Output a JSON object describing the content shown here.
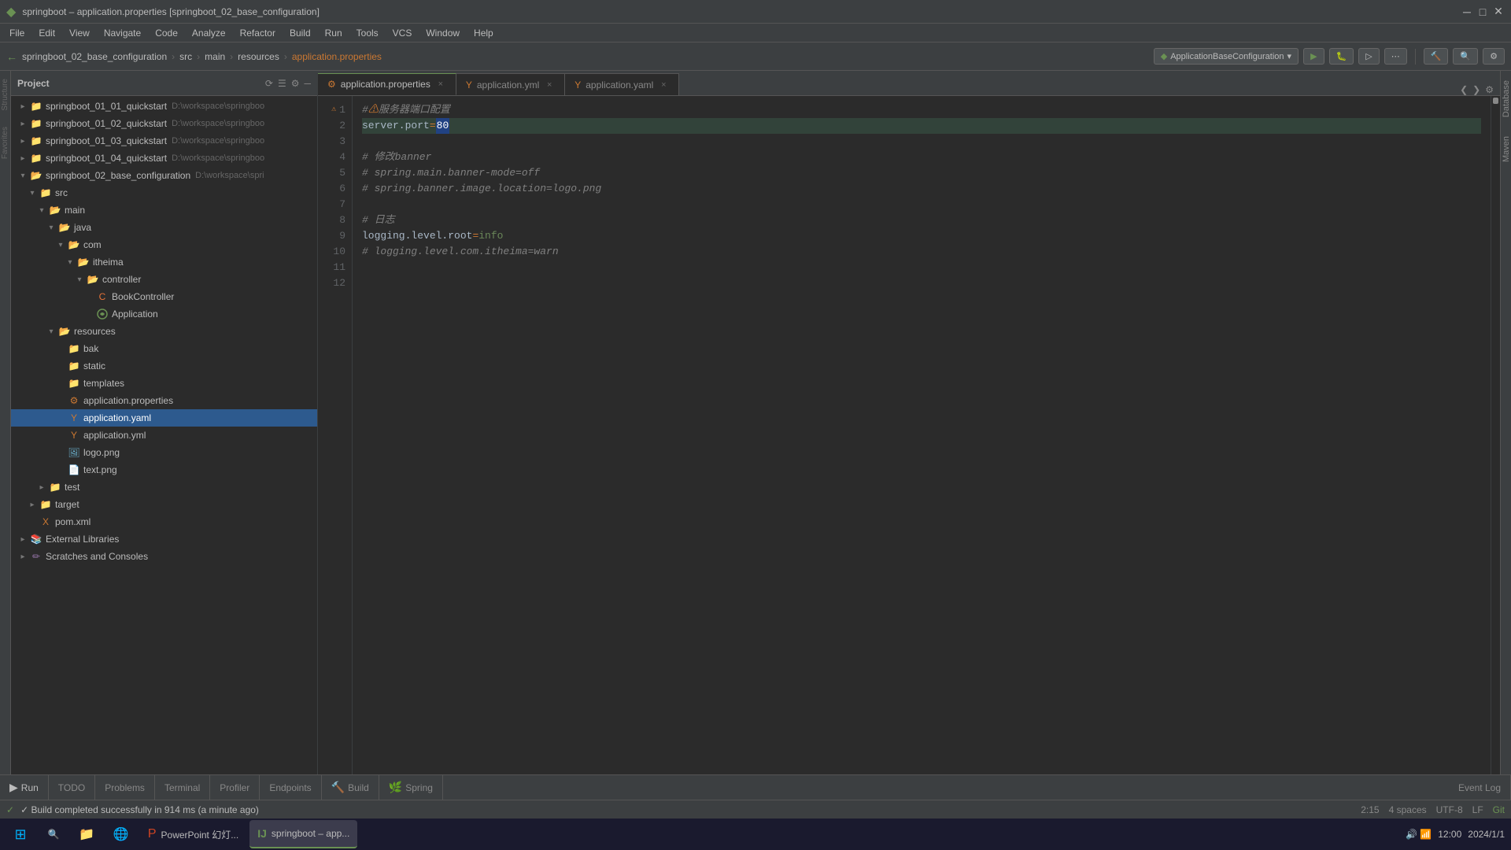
{
  "window": {
    "title": "springboot – application.properties [springboot_02_base_configuration]",
    "minimize": "─",
    "maximize": "□",
    "close": "✕"
  },
  "menu": {
    "items": [
      "File",
      "Edit",
      "View",
      "Navigate",
      "Code",
      "Analyze",
      "Refactor",
      "Build",
      "Run",
      "Tools",
      "VCS",
      "Window",
      "Help"
    ]
  },
  "toolbar": {
    "breadcrumb": [
      "springboot_02_base_configuration",
      "src",
      "main",
      "resources",
      "application.properties"
    ],
    "run_config": "ApplicationBaseConfiguration",
    "run_icon": "▶",
    "debug_icon": "🐛"
  },
  "project_panel": {
    "title": "Project",
    "dropdown_icon": "▾"
  },
  "tree": {
    "items": [
      {
        "id": "springboot_01_01",
        "label": "springboot_01_01_quickstart",
        "suffix": "D:\\workspace\\springboo",
        "indent": 1,
        "arrow": "closed",
        "type": "module"
      },
      {
        "id": "springboot_01_02",
        "label": "springboot_01_02_quickstart",
        "suffix": "D:\\workspace\\springboo",
        "indent": 1,
        "arrow": "closed",
        "type": "module"
      },
      {
        "id": "springboot_01_03",
        "label": "springboot_01_03_quickstart",
        "suffix": "D:\\workspace\\springboo",
        "indent": 1,
        "arrow": "closed",
        "type": "module"
      },
      {
        "id": "springboot_01_04",
        "label": "springboot_01_04_quickstart",
        "suffix": "D:\\workspace\\springboo",
        "indent": 1,
        "arrow": "closed",
        "type": "module"
      },
      {
        "id": "springboot_02",
        "label": "springboot_02_base_configuration",
        "suffix": "D:\\workspace\\spri",
        "indent": 1,
        "arrow": "open",
        "type": "module"
      },
      {
        "id": "src",
        "label": "src",
        "indent": 2,
        "arrow": "open",
        "type": "folder-src"
      },
      {
        "id": "main",
        "label": "main",
        "indent": 3,
        "arrow": "open",
        "type": "folder"
      },
      {
        "id": "java",
        "label": "java",
        "indent": 4,
        "arrow": "open",
        "type": "folder"
      },
      {
        "id": "com",
        "label": "com",
        "indent": 5,
        "arrow": "open",
        "type": "folder"
      },
      {
        "id": "itheima",
        "label": "itheima",
        "indent": 6,
        "arrow": "open",
        "type": "folder"
      },
      {
        "id": "controller",
        "label": "controller",
        "indent": 7,
        "arrow": "open",
        "type": "folder"
      },
      {
        "id": "BookController",
        "label": "BookController",
        "indent": 8,
        "arrow": "leaf",
        "type": "java-class"
      },
      {
        "id": "Application",
        "label": "Application",
        "indent": 8,
        "arrow": "leaf",
        "type": "spring"
      },
      {
        "id": "resources",
        "label": "resources",
        "indent": 4,
        "arrow": "open",
        "type": "folder"
      },
      {
        "id": "bak",
        "label": "bak",
        "indent": 5,
        "arrow": "leaf",
        "type": "folder"
      },
      {
        "id": "static",
        "label": "static",
        "indent": 5,
        "arrow": "leaf",
        "type": "folder"
      },
      {
        "id": "templates",
        "label": "templates",
        "indent": 5,
        "arrow": "leaf",
        "type": "folder"
      },
      {
        "id": "application.properties",
        "label": "application.properties",
        "indent": 5,
        "arrow": "leaf",
        "type": "properties"
      },
      {
        "id": "application.yaml",
        "label": "application.yaml",
        "indent": 5,
        "arrow": "leaf",
        "type": "yaml",
        "selected": true
      },
      {
        "id": "application.yml",
        "label": "application.yml",
        "indent": 5,
        "arrow": "leaf",
        "type": "yaml"
      },
      {
        "id": "logo.png",
        "label": "logo.png",
        "indent": 5,
        "arrow": "leaf",
        "type": "png"
      },
      {
        "id": "text.png",
        "label": "text.png",
        "indent": 5,
        "arrow": "leaf",
        "type": "png"
      },
      {
        "id": "test",
        "label": "test",
        "indent": 3,
        "arrow": "closed",
        "type": "folder"
      },
      {
        "id": "target",
        "label": "target",
        "indent": 2,
        "arrow": "closed",
        "type": "folder"
      },
      {
        "id": "pom.xml",
        "label": "pom.xml",
        "indent": 2,
        "arrow": "leaf",
        "type": "xml"
      },
      {
        "id": "external_libs",
        "label": "External Libraries",
        "indent": 1,
        "arrow": "closed",
        "type": "library"
      },
      {
        "id": "scratches",
        "label": "Scratches and Consoles",
        "indent": 1,
        "arrow": "closed",
        "type": "scratches"
      }
    ]
  },
  "tabs": [
    {
      "id": "application.properties",
      "label": "application.properties",
      "active": true,
      "modified": true,
      "type": "properties"
    },
    {
      "id": "application.yml",
      "label": "application.yml",
      "active": false,
      "modified": false,
      "type": "yaml"
    },
    {
      "id": "application.yaml",
      "label": "application.yaml",
      "active": false,
      "modified": false,
      "type": "yaml"
    }
  ],
  "editor": {
    "lines": [
      {
        "num": 1,
        "content": "#⚠️服务器端口配置",
        "type": "comment"
      },
      {
        "num": 2,
        "content": "server.port=80",
        "type": "property",
        "key": "server.port",
        "value": "80",
        "cursor": true
      },
      {
        "num": 3,
        "content": "",
        "type": "blank"
      },
      {
        "num": 4,
        "content": "# 修改banner",
        "type": "comment"
      },
      {
        "num": 5,
        "content": "# spring.main.banner-mode=off",
        "type": "comment"
      },
      {
        "num": 6,
        "content": "# spring.banner.image.location=logo.png",
        "type": "comment"
      },
      {
        "num": 7,
        "content": "",
        "type": "blank"
      },
      {
        "num": 8,
        "content": "# 日志",
        "type": "comment"
      },
      {
        "num": 9,
        "content": "logging.level.root=info",
        "type": "property",
        "key": "logging.level.root",
        "value": "info"
      },
      {
        "num": 10,
        "content": "# logging.level.com.itheima=warn",
        "type": "comment"
      },
      {
        "num": 11,
        "content": "",
        "type": "blank"
      },
      {
        "num": 12,
        "content": "",
        "type": "blank"
      }
    ]
  },
  "bottom_tabs": [
    {
      "id": "run",
      "label": "Run",
      "icon": "▶"
    },
    {
      "id": "todo",
      "label": "TODO",
      "icon": ""
    },
    {
      "id": "problems",
      "label": "Problems",
      "icon": ""
    },
    {
      "id": "terminal",
      "label": "Terminal",
      "icon": ""
    },
    {
      "id": "profiler",
      "label": "Profiler",
      "icon": ""
    },
    {
      "id": "endpoints",
      "label": "Endpoints",
      "icon": ""
    },
    {
      "id": "build",
      "label": "Build",
      "icon": "🔨"
    },
    {
      "id": "spring",
      "label": "Spring",
      "icon": "🌿"
    },
    {
      "id": "event_log",
      "label": "Event Log",
      "icon": ""
    }
  ],
  "status_bar": {
    "message": "✓  Build completed successfully in 914 ms (a minute ago)",
    "encoding": "UTF-8",
    "line_sep": "LF",
    "position": "2:15",
    "spaces": "4 spaces"
  },
  "taskbar": {
    "apps": [
      {
        "id": "windows",
        "label": "",
        "icon": "⊞"
      },
      {
        "id": "explorer",
        "label": "",
        "icon": "📁"
      },
      {
        "id": "chrome",
        "label": "",
        "icon": "🌐"
      },
      {
        "id": "powerpoint",
        "label": "PowerPoint 幻灯...",
        "icon": "P"
      },
      {
        "id": "intellij",
        "label": "springboot – app...",
        "icon": "IJ",
        "active": true
      }
    ]
  },
  "right_panel": {
    "tabs": [
      "Database",
      "Maven"
    ]
  }
}
